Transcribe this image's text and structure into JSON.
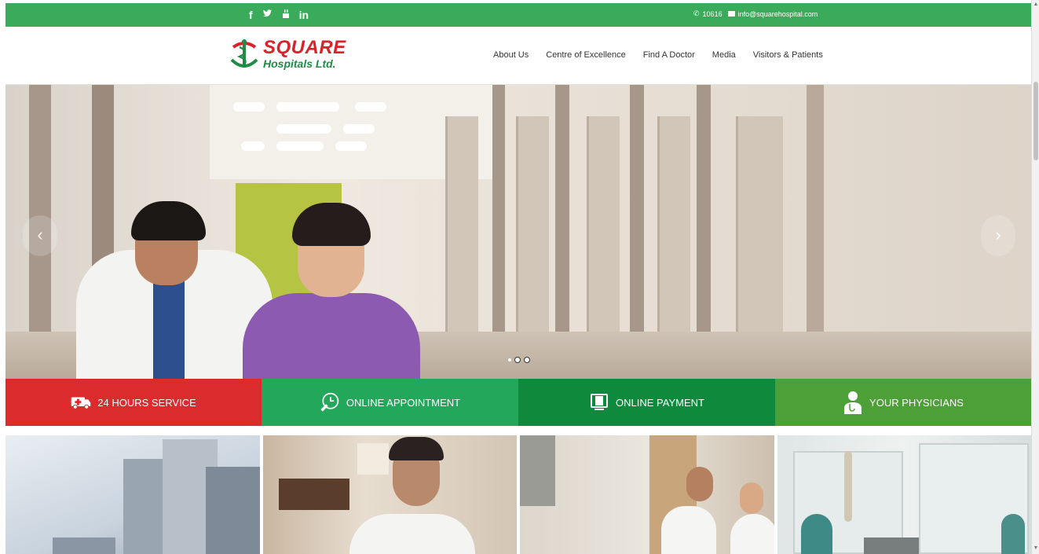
{
  "topbar": {
    "social": [
      {
        "name": "facebook-icon",
        "glyph": "f"
      },
      {
        "name": "twitter-icon",
        "glyph": "𝕪"
      },
      {
        "name": "youtube-icon",
        "glyph": "ⓨ"
      },
      {
        "name": "linkedin-icon",
        "glyph": "in"
      }
    ],
    "phone": "10616",
    "email": "info@squarehospital.com",
    "color": "#3aaa5b"
  },
  "header": {
    "logo_line1": "SQUARE",
    "logo_line2": "Hospitals Ltd.",
    "nav": [
      "About Us",
      "Centre of Excellence",
      "Find A Doctor",
      "Media",
      "Visitors & Patients"
    ]
  },
  "hero": {
    "prev_arrow": "‹",
    "next_arrow": "›"
  },
  "services": [
    {
      "label": "24 HOURS SERVICE",
      "icon": "ambulance-icon",
      "color": "#db2b2d"
    },
    {
      "label": "ONLINE APPOINTMENT",
      "icon": "clock-icon",
      "color": "#23a85b"
    },
    {
      "label": "ONLINE PAYMENT",
      "icon": "computer-icon",
      "color": "#0f8a3d"
    },
    {
      "label": "YOUR PHYSICIANS",
      "icon": "doctor-icon",
      "color": "#4d9f37"
    }
  ]
}
